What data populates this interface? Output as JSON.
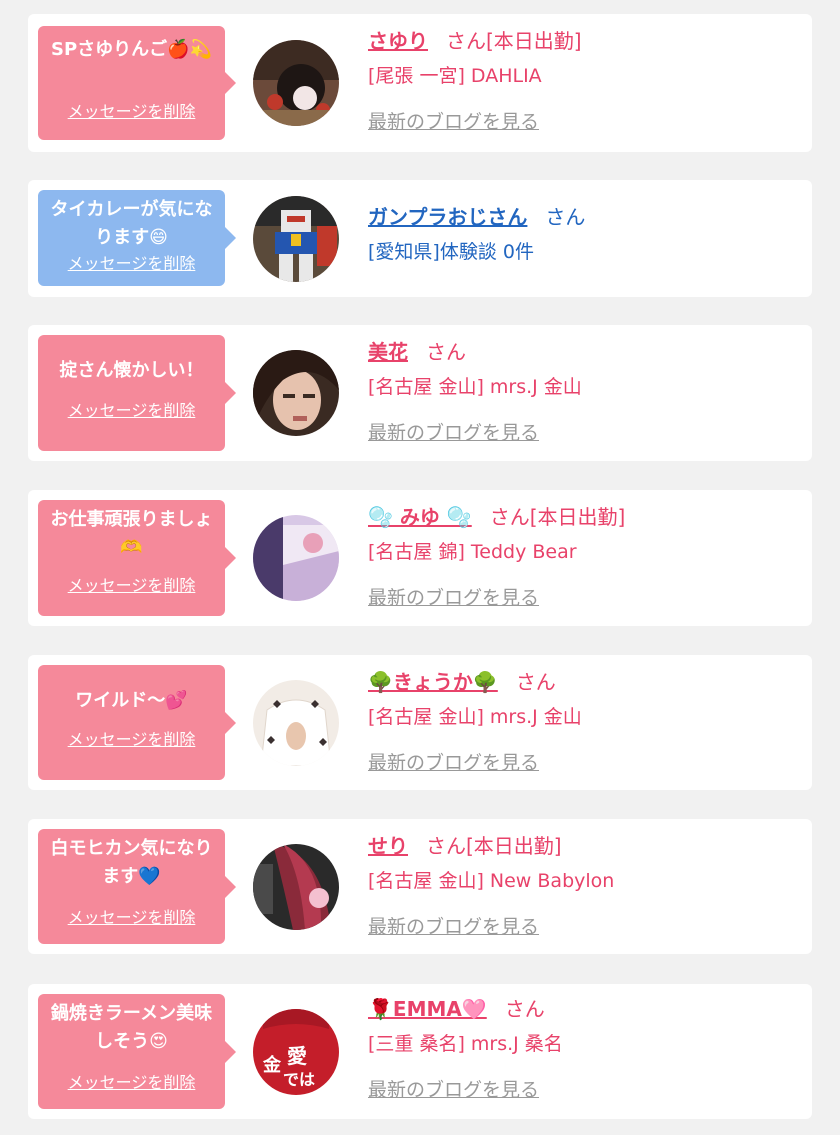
{
  "delete_label": "メッセージを削除",
  "blog_label": "最新のブログを見る",
  "items": [
    {
      "message": "SPさゆりんご🍎💫",
      "name": "さゆり",
      "suffix": "さん[本日出勤]",
      "shop": "[尾張 一宮] DAHLIA",
      "has_blog": true
    },
    {
      "message": "タイカレーが気になります😄",
      "name": "ガンプラおじさん",
      "suffix": "さん",
      "shop": "[愛知県]体験談 0件",
      "has_blog": false
    },
    {
      "message": "掟さん懐かしい！",
      "name": "美花",
      "suffix": "さん",
      "shop": "[名古屋 金山] mrs.J 金山",
      "has_blog": true
    },
    {
      "message": "お仕事頑張りましょ🫶",
      "name": "🫧 みゆ 🫧",
      "suffix": "さん[本日出勤]",
      "shop": "[名古屋 錦] Teddy Bear",
      "has_blog": true
    },
    {
      "message": "ワイルド～💕",
      "name": "🌳きょうか🌳",
      "suffix": "さん",
      "shop": "[名古屋 金山] mrs.J 金山",
      "has_blog": true
    },
    {
      "message": "白モヒカン気になります💙",
      "name": "せり",
      "suffix": "さん[本日出勤]",
      "shop": "[名古屋 金山] New Babylon",
      "has_blog": true
    },
    {
      "message": "鍋焼きラーメン美味しそう😍",
      "name": "🌹EMMA🩷",
      "suffix": "さん",
      "shop": "[三重 桑名] mrs.J 桑名",
      "has_blog": true
    }
  ],
  "avatar_texts": {
    "item7": "金",
    "item7b": "愛",
    "item7c": "では"
  },
  "colors": {
    "accent_pink": "#e8426a",
    "bubble_pink": "#f5899a",
    "bubble_blue": "#8db8ef",
    "link_blue": "#2266c0"
  }
}
